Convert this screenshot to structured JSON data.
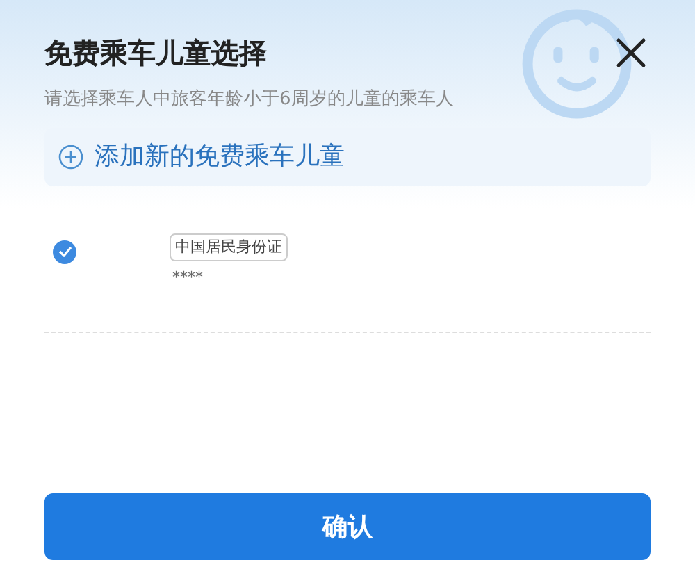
{
  "title": "免费乘车儿童选择",
  "subtitle": "请选择乘车人中旅客年龄小于6周岁的儿童的乘车人",
  "add_button": {
    "label": "添加新的免费乘车儿童"
  },
  "passengers": [
    {
      "selected": true,
      "id_type": "中国居民身份证",
      "id_number": "****"
    }
  ],
  "confirm_button": {
    "label": "确认"
  }
}
